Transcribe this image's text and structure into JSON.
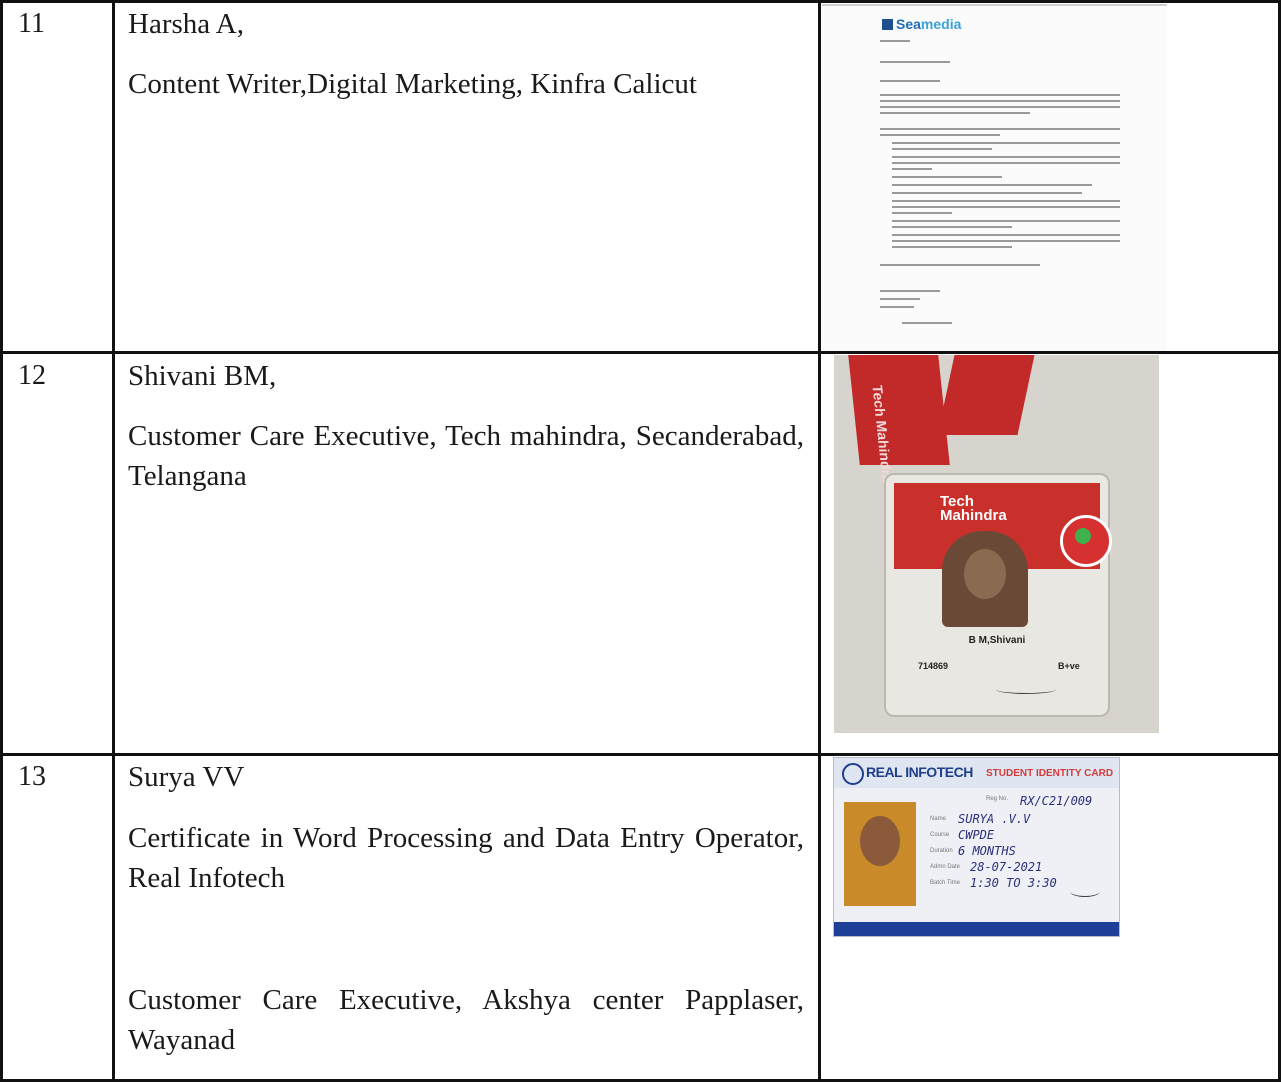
{
  "rows": [
    {
      "number": "11",
      "name": "Harsha A,",
      "description": "Content Writer,Digital Marketing, Kinfra Calicut",
      "document": {
        "logo_prefix": "Sea",
        "logo_suffix": "media"
      }
    },
    {
      "number": "12",
      "name": "Shivani BM,",
      "description": "Customer Care Executive, Tech mahindra, Secanderabad, Telangana",
      "id_card": {
        "brand": "Tech Mahindra",
        "name": "B M,Shivani",
        "id": "714869",
        "blood_group": "B+ve"
      }
    },
    {
      "number": "13",
      "name": "Surya VV",
      "description": "Certificate in Word Processing and Data Entry Operator, Real Infotech",
      "description2": "Customer Care Executive, Akshya center Papplaser, Wayanad",
      "student_card": {
        "brand": "REAL INFOTECH",
        "title": "STUDENT IDENTITY CARD",
        "reg_no": "RX/C21/009",
        "name": "SURYA .V.V",
        "course": "CWPDE",
        "duration": "6 MONTHS",
        "admn_date": "28-07-2021",
        "batch_time": "1:30 TO 3:30"
      }
    }
  ]
}
